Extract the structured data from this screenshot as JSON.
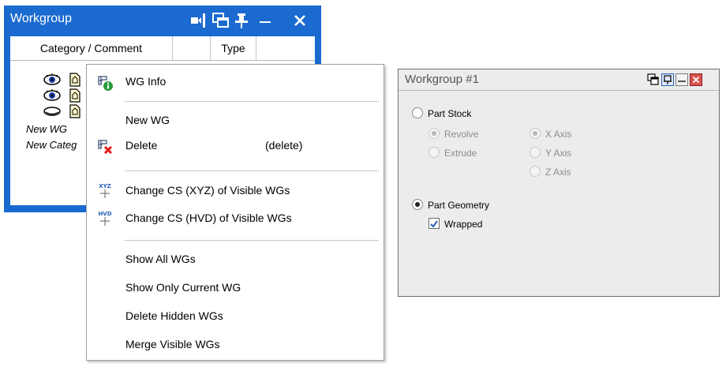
{
  "workgroup_panel": {
    "title": "Workgroup",
    "columns": [
      "Category / Comment",
      "Type"
    ],
    "rows": [
      {
        "type": "icons",
        "visibility": "eye-open"
      },
      {
        "type": "icons",
        "visibility": "eye-open"
      },
      {
        "type": "icons",
        "visibility": "eye-closed"
      },
      {
        "type": "text",
        "label": "New WG"
      },
      {
        "type": "text",
        "label": "New Categ"
      }
    ]
  },
  "context_menu": {
    "items": [
      {
        "label": "WG Info",
        "icon": "wg-info-icon"
      },
      {
        "label": "New WG"
      },
      {
        "label": "Delete",
        "shortcut": "(delete)",
        "icon": "delete-icon"
      },
      {
        "label": "Change CS (XYZ) of Visible WGs",
        "icon": "xyz-icon",
        "icon_text": "XYZ"
      },
      {
        "label": "Change CS (HVD) of Visible WGs",
        "icon": "hvd-icon",
        "icon_text": "HVD"
      },
      {
        "label": "Show All WGs"
      },
      {
        "label": "Show Only Current WG"
      },
      {
        "label": "Delete Hidden WGs"
      },
      {
        "label": "Merge Visible WGs"
      }
    ]
  },
  "workgroup1": {
    "title": "Workgroup #1",
    "part_stock": {
      "label": "Part Stock",
      "selected": false,
      "methods": [
        {
          "label": "Revolve",
          "selected": true
        },
        {
          "label": "Extrude",
          "selected": false
        }
      ],
      "axes": [
        {
          "label": "X Axis",
          "selected": true
        },
        {
          "label": "Y Axis",
          "selected": false
        },
        {
          "label": "Z Axis",
          "selected": false
        }
      ]
    },
    "part_geometry": {
      "label": "Part Geometry",
      "selected": true
    },
    "wrapped": {
      "label": "Wrapped",
      "checked": true
    }
  },
  "colors": {
    "panel_blue": "#1a6ad0",
    "accent": "#2a5fb8",
    "delete_red": "#e21b1b"
  }
}
